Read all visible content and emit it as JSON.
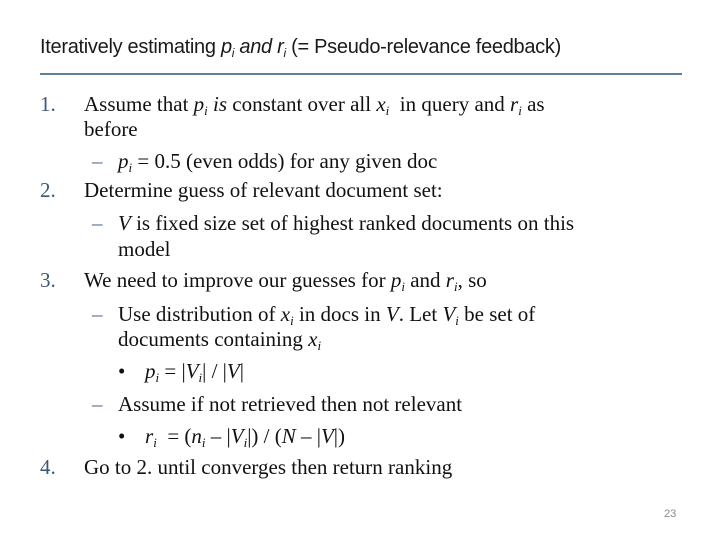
{
  "slide": {
    "title": {
      "prefix": "Iteratively estimating ",
      "p": "p",
      "p_sub": "i",
      "and": " and ",
      "r": "r",
      "r_sub": "i",
      "suffix": " (= Pseudo-relevance feedback)"
    },
    "page_number": "23",
    "items": [
      {
        "number": "1.",
        "text_a": "Assume that ",
        "var_p": "p",
        "sub": "i",
        "text_b": " is",
        "text_c": " constant over all ",
        "var_x": "x",
        "text_d": "  in query and ",
        "var_r": "r",
        "text_e": " as",
        "continuation": "before",
        "sub_items": [
          {
            "marker": "–",
            "var": "p",
            "sub": "i",
            "text": " = 0.5 (even odds) for any given doc"
          }
        ]
      },
      {
        "number": "2.",
        "text": "Determine guess of relevant document set:",
        "sub_items": [
          {
            "marker": "–",
            "var": "V",
            "text": " is fixed size set of highest ranked documents on this",
            "continuation": "model"
          }
        ]
      },
      {
        "number": "3.",
        "text_a": "We need to improve our guesses for ",
        "var_p": "p",
        "sub": "i",
        "text_b": " and ",
        "var_r": "r",
        "text_c": ", so",
        "sub_items": [
          {
            "marker": "–",
            "text_a": "Use distribution of ",
            "var_x": "x",
            "sub": "i",
            "text_b": " in docs in ",
            "var_V": "V",
            "text_c": ". Let ",
            "var_Vi": "V",
            "text_d": " be set of",
            "continuation_a": "documents containing ",
            "continuation_var": "x",
            "bullet": {
              "marker": "•",
              "formula_lhs": "p",
              "sub": "i",
              "formula_rhs_a": " = |",
              "V1": "V",
              "formula_rhs_b": "| / |",
              "V2": "V",
              "formula_rhs_c": "|"
            }
          },
          {
            "marker": "–",
            "text": "Assume if not retrieved then not relevant",
            "bullet": {
              "marker": "•",
              "formula_lhs": "r",
              "sub": "i",
              "eq": "  = (",
              "n": "n",
              "mid": " – |",
              "V1": "V",
              "mid2": "|) / (",
              "N": "N",
              "mid3": " – |",
              "V2": "V",
              "end": "|)"
            }
          }
        ]
      },
      {
        "number": "4.",
        "text": "Go to 2. until converges then return ranking"
      }
    ]
  }
}
